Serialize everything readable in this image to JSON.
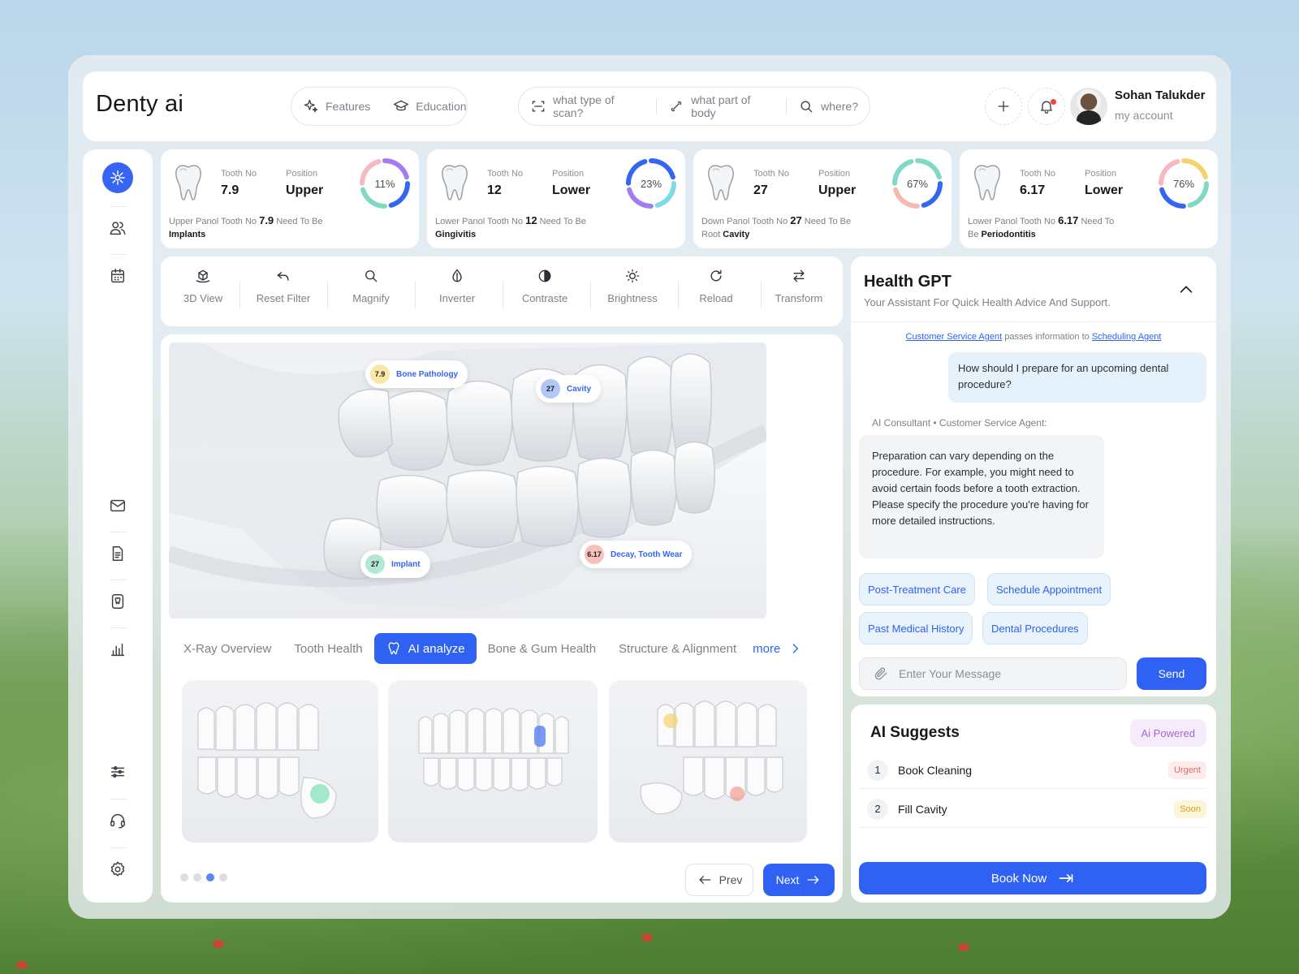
{
  "app": {
    "brand": "Denty ai"
  },
  "header": {
    "nav": [
      {
        "label": "Features",
        "icon": "sparkles-icon"
      },
      {
        "label": "Education",
        "icon": "graduation-cap-icon"
      }
    ],
    "search": [
      {
        "placeholder": "what type of scan?",
        "icon": "scan-icon"
      },
      {
        "placeholder": "what part of body",
        "icon": "bone-icon"
      },
      {
        "placeholder": "where?",
        "icon": "search-icon"
      }
    ],
    "user": {
      "name": "Sohan Talukder",
      "subtitle": "my account"
    }
  },
  "tooth_cards": [
    {
      "tooth_label": "Tooth No",
      "tooth_no": "7.9",
      "position_label": "Position",
      "position": "Upper",
      "percent_label": "11%",
      "percent": 11,
      "desc_prefix": "Upper Panol Tooth No",
      "desc_num": "7.9",
      "desc_mid": "Need To Be",
      "desc_bold": "Implants"
    },
    {
      "tooth_label": "Tooth No",
      "tooth_no": "12",
      "position_label": "Position",
      "position": "Lower",
      "percent_label": "23%",
      "percent": 23,
      "desc_prefix": "Lower Panol Tooth No",
      "desc_num": "12",
      "desc_mid": "Need To Be",
      "desc_bold": "Gingivitis"
    },
    {
      "tooth_label": "Tooth No",
      "tooth_no": "27",
      "position_label": "Position",
      "position": "Upper",
      "percent_label": "67%",
      "percent": 67,
      "desc_prefix": "Down Panol Tooth No",
      "desc_num": "27",
      "desc_mid": "Need To Be Root",
      "desc_bold": "Cavity"
    },
    {
      "tooth_label": "Tooth No",
      "tooth_no": "6.17",
      "position_label": "Position",
      "position": "Lower",
      "percent_label": "76%",
      "percent": 76,
      "desc_prefix": "Lower Panol Tooth No",
      "desc_num": "6.17",
      "desc_mid": "Need To Be",
      "desc_bold": "Periodontitis"
    }
  ],
  "toolbar": [
    {
      "label": "3D View",
      "icon": "cube-view-icon"
    },
    {
      "label": "Reset Filter",
      "icon": "undo-icon"
    },
    {
      "label": "Magnify",
      "icon": "magnify-icon"
    },
    {
      "label": "Inverter",
      "icon": "drop-icon"
    },
    {
      "label": "Contraste",
      "icon": "contrast-icon"
    },
    {
      "label": "Brightness",
      "icon": "brightness-icon"
    },
    {
      "label": "Reload",
      "icon": "reload-icon"
    },
    {
      "label": "Transform",
      "icon": "transform-icon"
    }
  ],
  "markers": [
    {
      "num": "7.9",
      "label": "Bone Pathology",
      "color": "#fbe7a8"
    },
    {
      "num": "27",
      "label": "Cavity",
      "color": "#b3c7f7"
    },
    {
      "num": "27",
      "label": "Implant",
      "color": "#b3e8d6"
    },
    {
      "num": "6.17",
      "label": "Decay, Tooth Wear",
      "color": "#f7c1bc"
    }
  ],
  "tabs": [
    {
      "label": "X-Ray Overview"
    },
    {
      "label": "Tooth Health"
    },
    {
      "label": "AI analyze",
      "active": true
    },
    {
      "label": "Bone & Gum Health"
    },
    {
      "label": "Structure & Alignment"
    },
    {
      "label": "more"
    }
  ],
  "pager": {
    "prev": "Prev",
    "next": "Next",
    "pages": 4,
    "current": 3
  },
  "health_gpt": {
    "title": "Health GPT",
    "subtitle": "Your Assistant For Quick Health Advice And Support.",
    "handoff": {
      "from": "Customer Service Agent",
      "mid": "passes information to",
      "to": "Scheduling Agent"
    },
    "user_message": "How should I prepare for an upcoming dental procedure?",
    "bot_label": "AI Consultant • Customer Service Agent:",
    "bot_message": "Preparation can vary depending on the procedure. For example, you might need to avoid certain foods before a tooth extraction. Please specify the procedure you're having for more detailed instructions.",
    "chips": [
      "Post-Treatment Care",
      "Schedule Appointment",
      "Past Medical History",
      "Dental Procedures"
    ],
    "input_placeholder": "Enter Your Message",
    "send": "Send"
  },
  "ai_suggests": {
    "title": "AI Suggests",
    "badge": "Ai Powered",
    "items": [
      {
        "num": "1",
        "text": "Book Cleaning",
        "tag": "Urgent",
        "tag_color": "#e06a6a",
        "tag_bg": "#fdecec"
      },
      {
        "num": "2",
        "text": "Fill Cavity",
        "tag": "Soon",
        "tag_color": "#d9a21a",
        "tag_bg": "#fdf4dc"
      }
    ],
    "book": "Book Now"
  },
  "colors": {
    "accent": "#2f62f2",
    "chip_bg": "#e9f3fc",
    "ai_badge": "#a06ad6"
  }
}
